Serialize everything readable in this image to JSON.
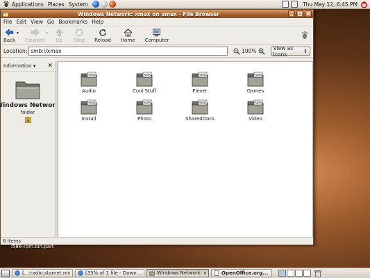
{
  "top_panel": {
    "menus": [
      "Applications",
      "Places",
      "System"
    ],
    "clock": "Thu May 12,  6:45 PM"
  },
  "window": {
    "title": "Windows Network: xmax on xmax - File Browser",
    "menubar": [
      "File",
      "Edit",
      "View",
      "Go",
      "Bookmarks",
      "Help"
    ],
    "toolbar": {
      "back": "Back",
      "forward": "Forward",
      "up": "Up",
      "stop": "Stop",
      "reload": "Reload",
      "home": "Home",
      "computer": "Computer"
    },
    "location": {
      "label": "Location:",
      "value": "smb://xmax",
      "zoom": "100%",
      "view_mode": "View as Icons"
    },
    "sidepane": {
      "selector": "Information",
      "title": "Windows Network",
      "subtitle": "folder"
    },
    "items": [
      "Audio",
      "Cool Stuff",
      "Flexer",
      "Games",
      "Install",
      "Photo",
      "SharedDocs",
      "Video"
    ],
    "status": "8 items"
  },
  "desktop": {
    "file_label": "i586-rpm.bin.part"
  },
  "taskbar": {
    "tasks": [
      "[...:radio.starnet.md:...",
      "[33% of 1 file - Down...",
      "Windows Network: x...",
      "OpenOffice.org..."
    ]
  },
  "colors": {
    "titlebar": "#a8622f",
    "window_bg": "#efebe6",
    "desktop": "#5e3418"
  }
}
